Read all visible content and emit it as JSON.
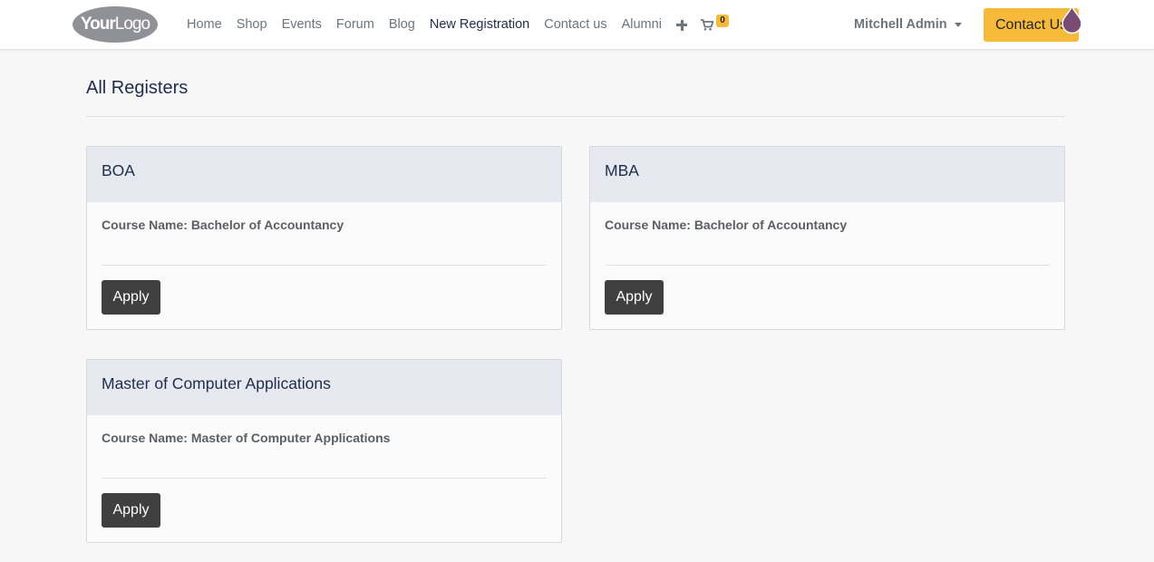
{
  "header": {
    "logo": {
      "bold": "Your",
      "light": "Logo"
    },
    "menu": [
      "Home",
      "Shop",
      "Events",
      "Forum",
      "Blog",
      "New Registration",
      "Contact us",
      "Alumni"
    ],
    "active_menu": "New Registration",
    "cart_count": "0",
    "user_name": "Mitchell Admin",
    "contact_button": "Contact Us"
  },
  "main": {
    "title": "All Registers",
    "cards": [
      {
        "title": "BOA",
        "course_label": "Course Name:",
        "course_name": "Bachelor of Accountancy",
        "button": "Apply"
      },
      {
        "title": "MBA",
        "course_label": "Course Name:",
        "course_name": "Bachelor of Accountancy",
        "button": "Apply"
      },
      {
        "title": "Master of Computer Applications",
        "course_label": "Course Name:",
        "course_name": "Master of Computer Applications",
        "button": "Apply"
      }
    ]
  },
  "colors": {
    "accent": "#f7b93a",
    "apply_button": "#3f3f3f",
    "card_header": "#e6e9f0",
    "title_text": "#1f2d4b"
  },
  "icons": [
    "plus-icon",
    "cart-icon",
    "caret-down-icon",
    "drop-icon"
  ]
}
